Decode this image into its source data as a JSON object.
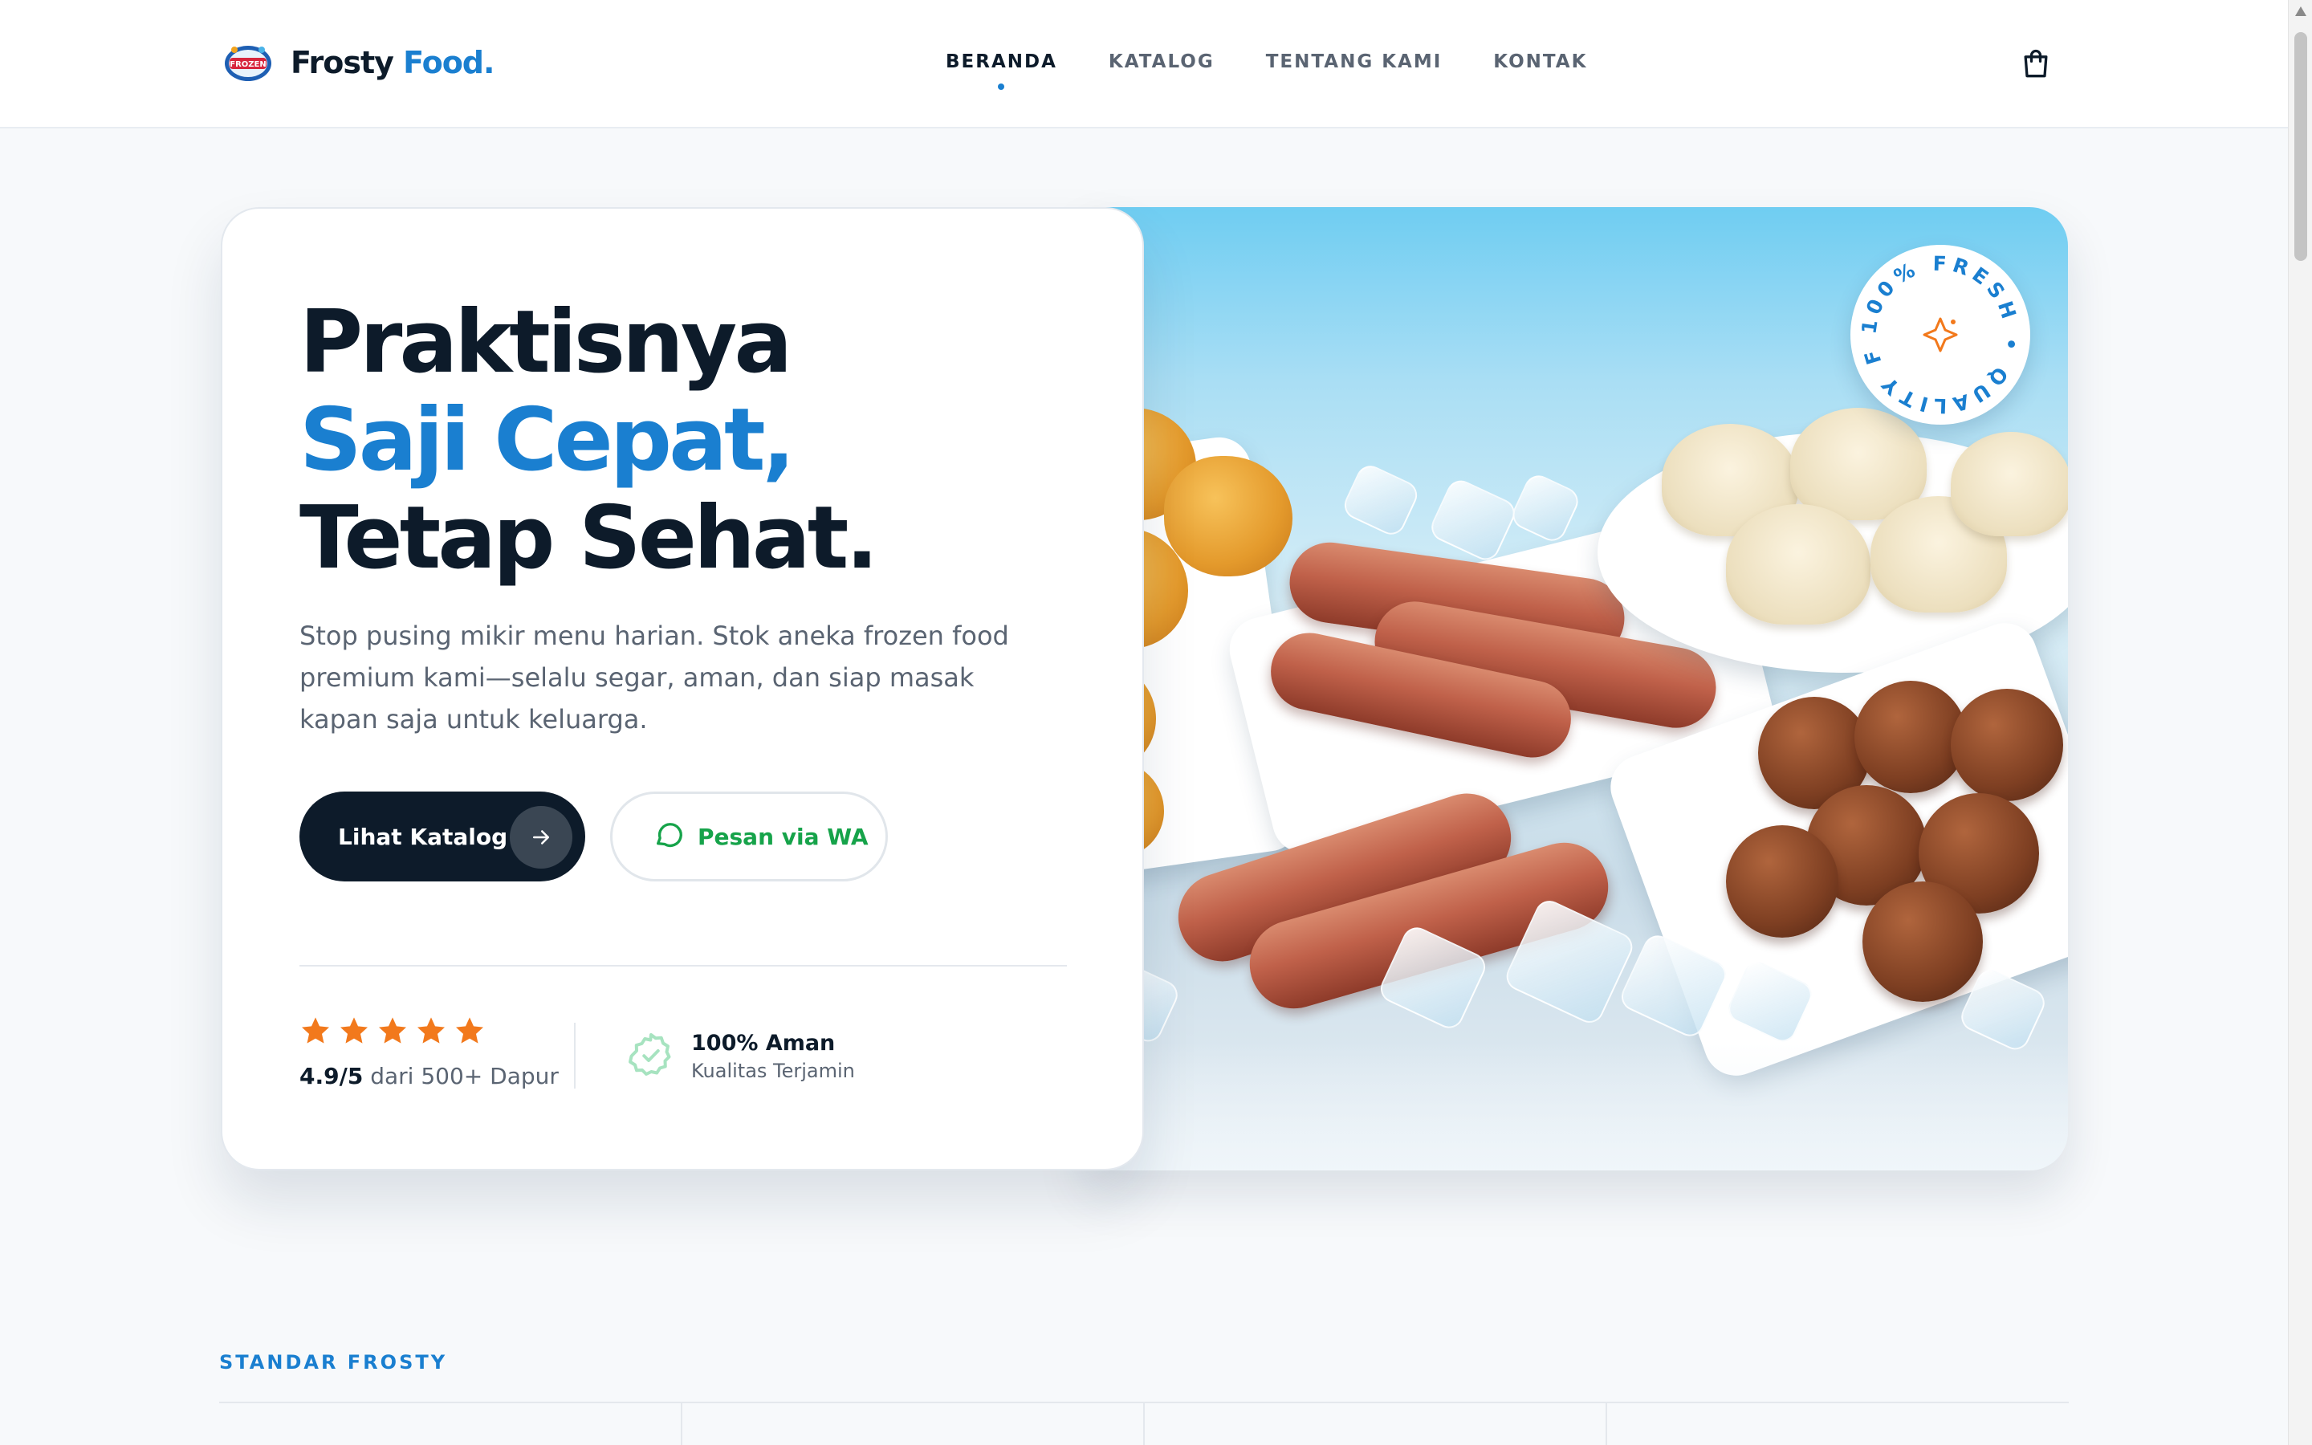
{
  "header": {
    "logo_badge_text": "FROZEN",
    "brand_main": "Frosty",
    "brand_accent": "Food.",
    "nav": [
      {
        "label": "BERANDA",
        "active": true
      },
      {
        "label": "KATALOG",
        "active": false
      },
      {
        "label": "TENTANG KAMI",
        "active": false
      },
      {
        "label": "KONTAK",
        "active": false
      }
    ],
    "cart_icon": "shopping-bag-icon"
  },
  "hero": {
    "headline_line1": "Praktisnya",
    "headline_line2": "Saji Cepat,",
    "headline_line3": "Tetap Sehat.",
    "description": "Stop pusing mikir menu harian. Stok aneka frozen food premium kami—selalu segar, aman, dan siap masak kapan saja untuk keluarga.",
    "primary_button": "Lihat Katalog",
    "wa_button": "Pesan via WA",
    "rating_value": "4.9/5",
    "rating_text": "dari 500+ Dapur",
    "stars": 5,
    "safe_title": "100% Aman",
    "safe_subtitle": "Kualitas Terjamin",
    "badge_text": "100% FRESH • QUALITY F"
  },
  "section": {
    "label": "STANDAR FROSTY"
  },
  "colors": {
    "accent": "#1a7fd0",
    "dark": "#0d1b2a",
    "star": "#f2791c",
    "whatsapp": "#16a34a"
  }
}
